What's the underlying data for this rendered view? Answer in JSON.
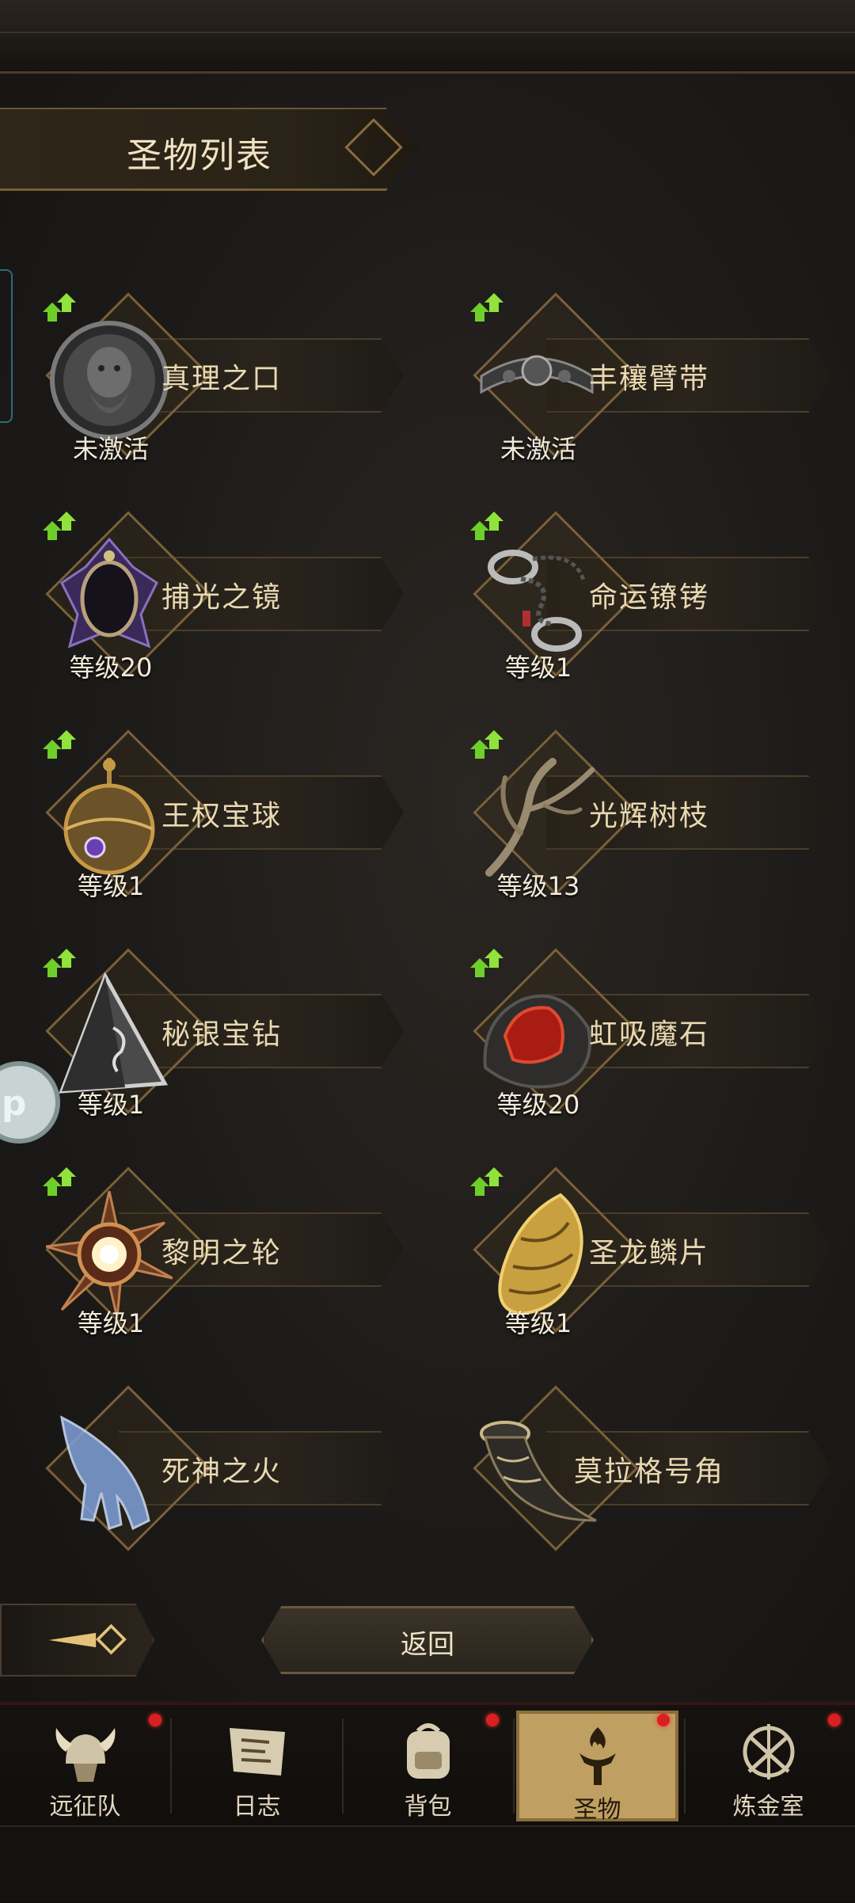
{
  "header": {
    "title": "圣物列表"
  },
  "relics": [
    {
      "name": "真理之口",
      "level": "未激活",
      "icon": "stone-face-icon"
    },
    {
      "name": "丰穰臂带",
      "level": "未激活",
      "icon": "armband-icon"
    },
    {
      "name": "捕光之镜",
      "level": "等级20",
      "icon": "crystal-mirror-icon"
    },
    {
      "name": "命运镣铐",
      "level": "等级1",
      "icon": "shackles-icon"
    },
    {
      "name": "王权宝球",
      "level": "等级1",
      "icon": "royal-orb-icon"
    },
    {
      "name": "光辉树枝",
      "level": "等级13",
      "icon": "branch-icon"
    },
    {
      "name": "秘银宝钻",
      "level": "等级1",
      "icon": "mithril-pyramid-icon"
    },
    {
      "name": "虹吸魔石",
      "level": "等级20",
      "icon": "siphon-stone-icon"
    },
    {
      "name": "黎明之轮",
      "level": "等级1",
      "icon": "dawn-wheel-icon"
    },
    {
      "name": "圣龙鳞片",
      "level": "等级1",
      "icon": "dragon-scale-icon"
    },
    {
      "name": "死神之火",
      "level": "",
      "icon": "ghost-hand-icon"
    },
    {
      "name": "莫拉格号角",
      "level": "",
      "icon": "horn-icon"
    }
  ],
  "actions": {
    "return_label": "返回"
  },
  "side_bubble": {
    "text": "p"
  },
  "bottom_nav": [
    {
      "label": "远征队",
      "icon": "viking-helmet-icon",
      "active": false,
      "badge": true
    },
    {
      "label": "日志",
      "icon": "scroll-icon",
      "active": false,
      "badge": false
    },
    {
      "label": "背包",
      "icon": "backpack-icon",
      "active": false,
      "badge": true
    },
    {
      "label": "圣物",
      "icon": "torch-icon",
      "active": true,
      "badge": true
    },
    {
      "label": "炼金室",
      "icon": "alchemy-icon",
      "active": false,
      "badge": true
    }
  ],
  "colors": {
    "accent_gold": "#bf9f62",
    "badge_red": "#d92020",
    "upgrade_green": "#7ed321"
  }
}
